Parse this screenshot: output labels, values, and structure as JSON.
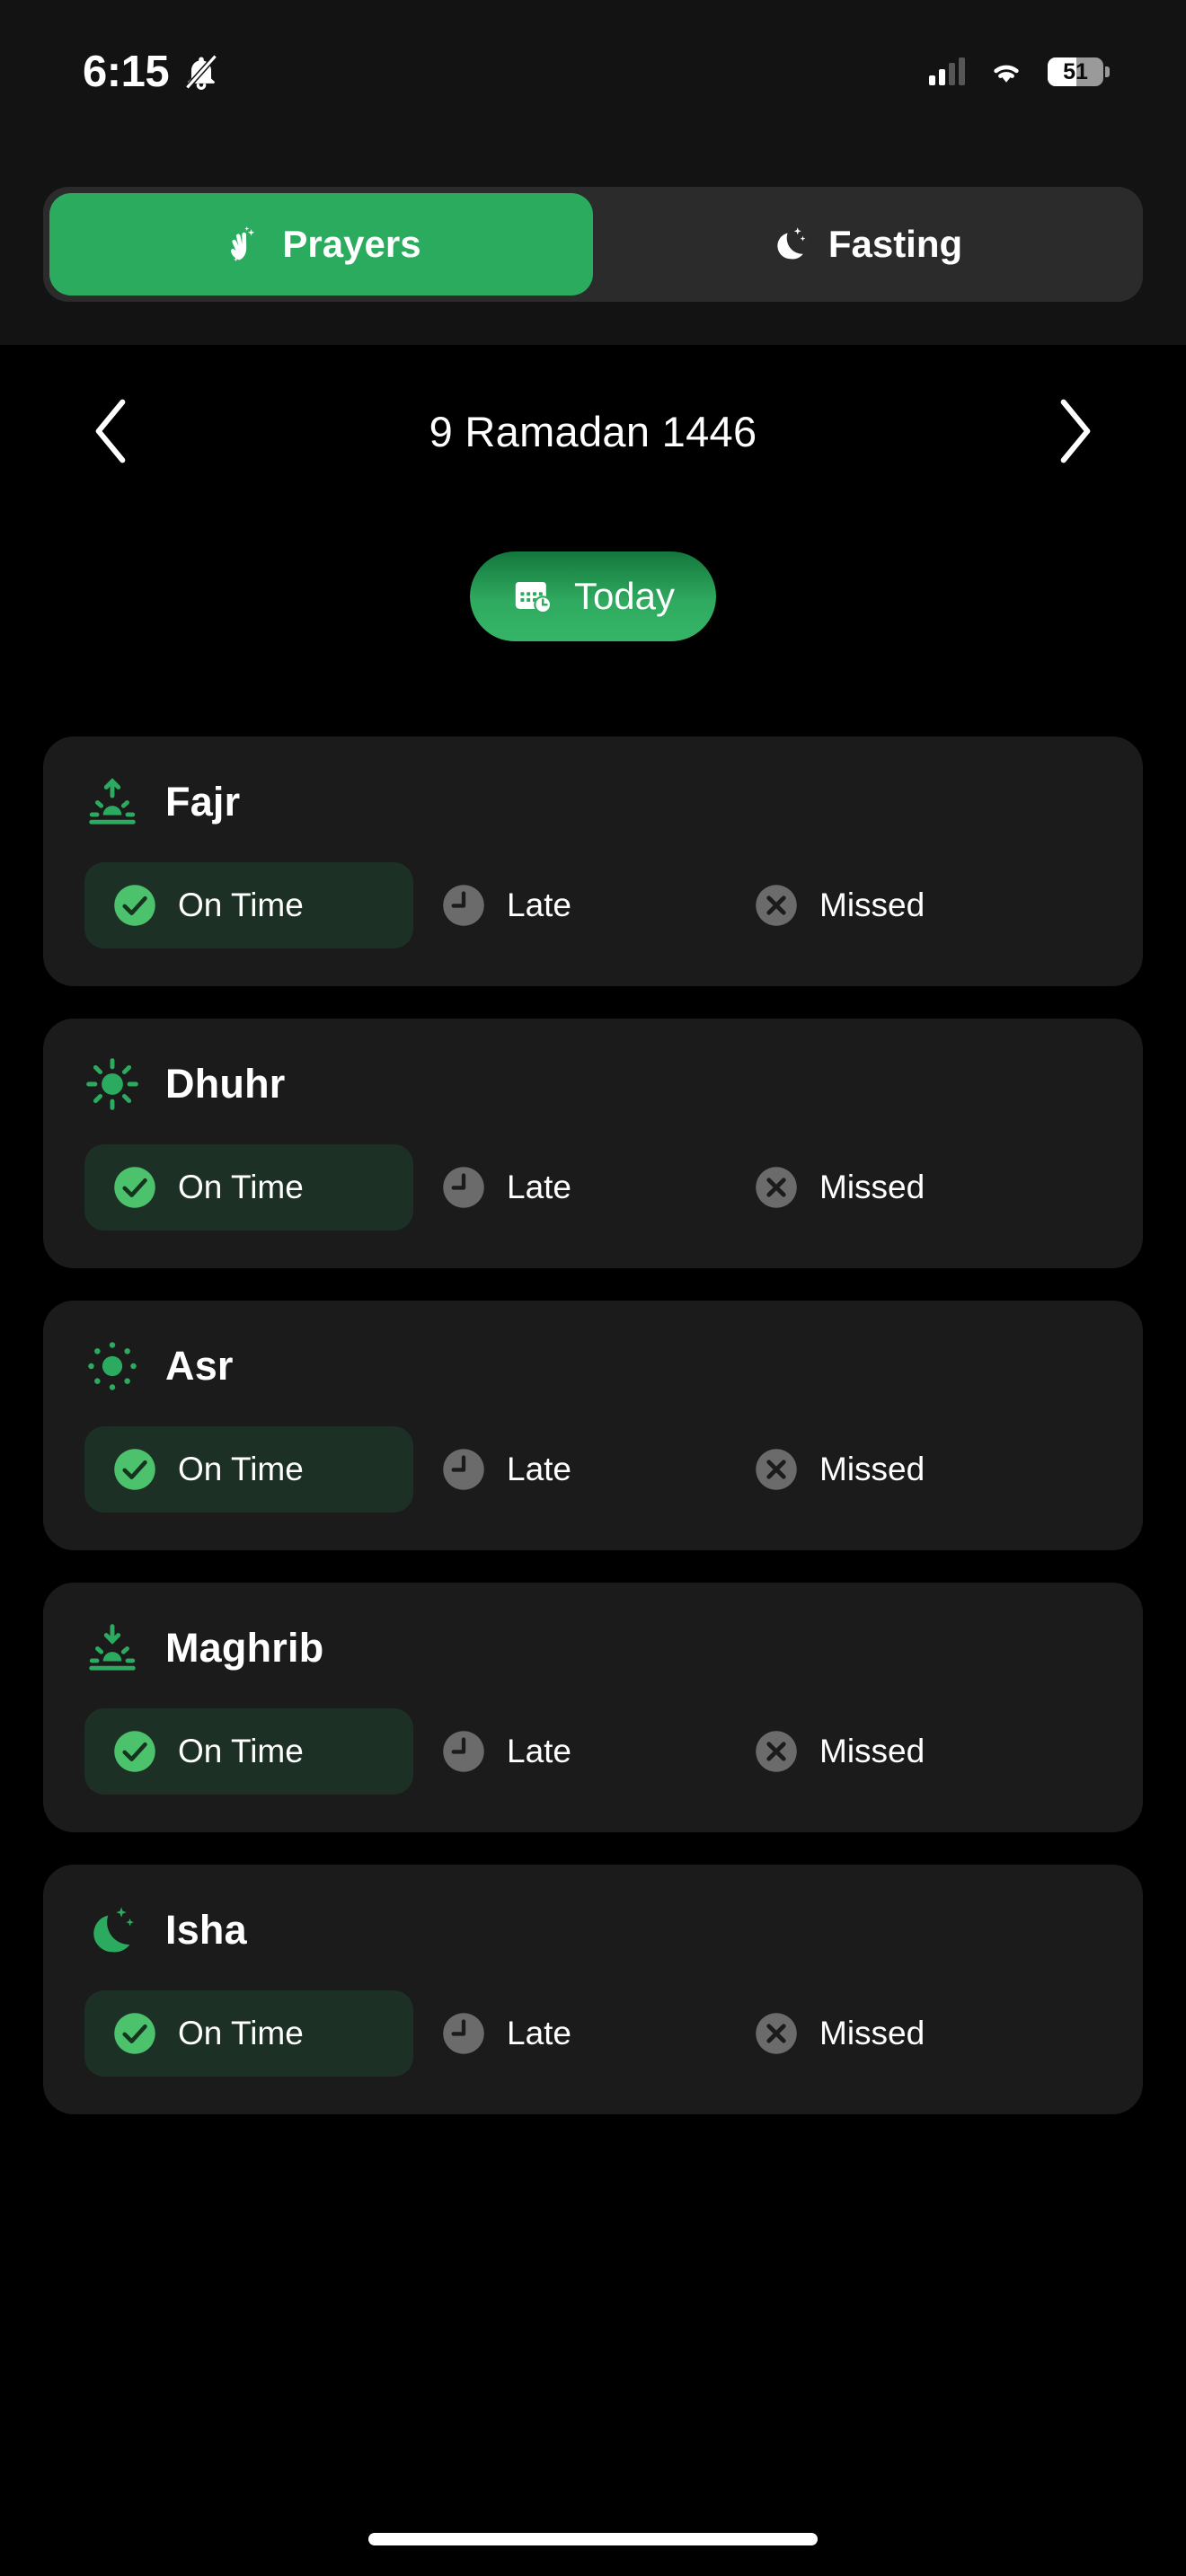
{
  "status_bar": {
    "time": "6:15",
    "mute_icon": "bell-muted-icon",
    "signal_icon": "cellular-signal-icon",
    "wifi_icon": "wifi-icon",
    "battery_percent": "51"
  },
  "tabs": [
    {
      "label": "Prayers",
      "icon": "praying-hands-icon",
      "active": true
    },
    {
      "label": "Fasting",
      "icon": "crescent-moon-stars-icon",
      "active": false
    }
  ],
  "date_nav": {
    "prev_icon": "chevron-left-icon",
    "next_icon": "chevron-right-icon",
    "title": "9 Ramadan 1446"
  },
  "today_button": {
    "label": "Today",
    "icon": "calendar-clock-icon",
    "color": "#2faa5f"
  },
  "status_options": {
    "on_time": "On Time",
    "late": "Late",
    "missed": "Missed"
  },
  "colors": {
    "accent_green": "#2aab5e",
    "icon_green": "#2cab60",
    "selected_bg": "#1d3026",
    "card_bg": "#1b1b1b",
    "page_bg": "#000000",
    "inactive_gray": "#6b6b6b"
  },
  "prayers": [
    {
      "name": "Fajr",
      "icon": "sunrise-icon",
      "selected": "on_time"
    },
    {
      "name": "Dhuhr",
      "icon": "sun-icon",
      "selected": "on_time"
    },
    {
      "name": "Asr",
      "icon": "sun-dotted-icon",
      "selected": "on_time"
    },
    {
      "name": "Maghrib",
      "icon": "sunset-icon",
      "selected": "on_time"
    },
    {
      "name": "Isha",
      "icon": "crescent-moon-icon",
      "selected": "on_time"
    }
  ]
}
